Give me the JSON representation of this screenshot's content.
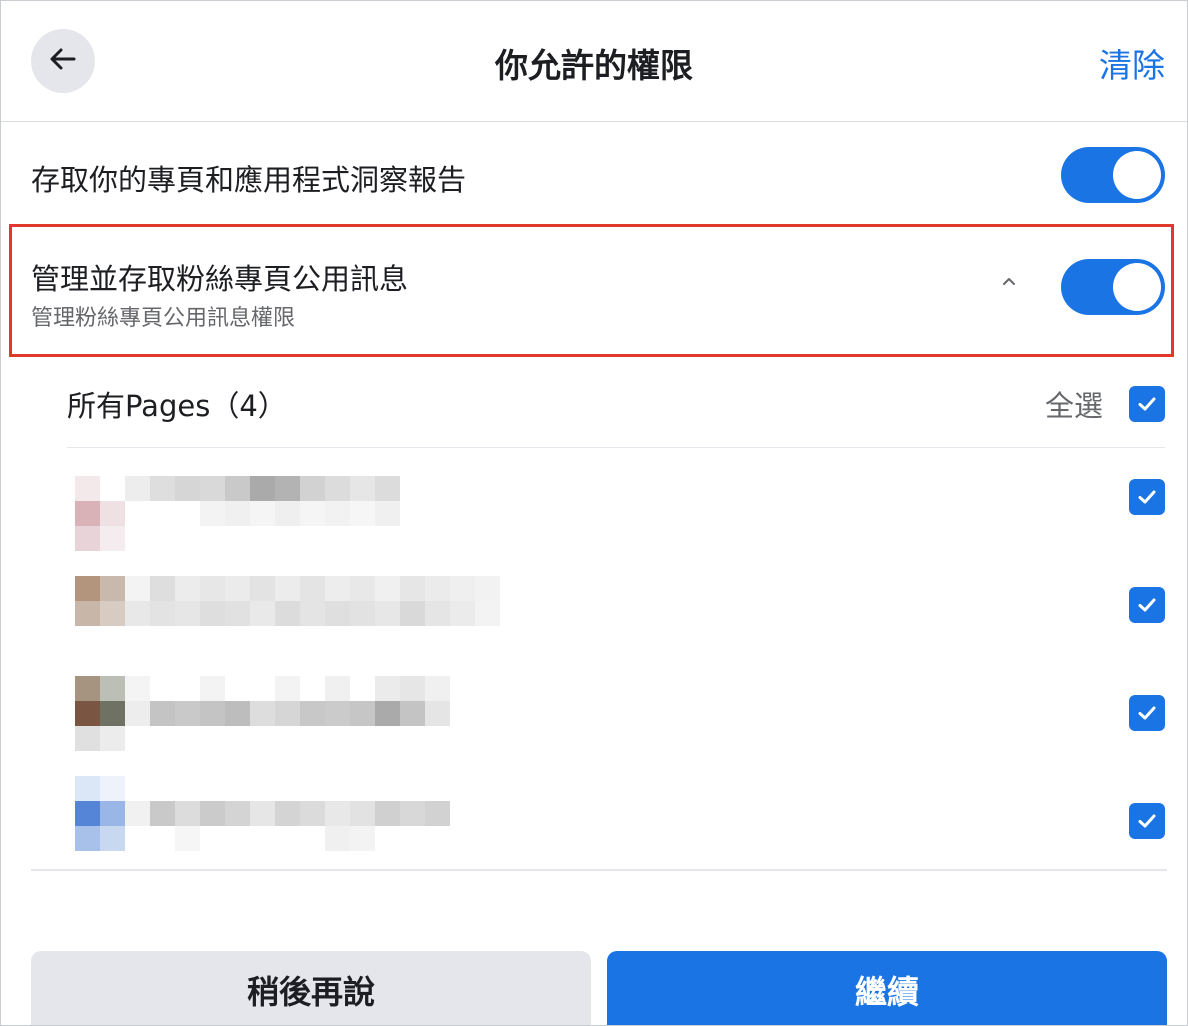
{
  "header": {
    "title": "你允許的權限",
    "clear_label": "清除",
    "back_icon": "arrow-left-icon"
  },
  "permissions": [
    {
      "title": "存取你的專頁和應用程式洞察報告",
      "enabled": true
    },
    {
      "title": "管理並存取粉絲專頁公用訊息",
      "subtitle": "管理粉絲專頁公用訊息權限",
      "enabled": true,
      "expanded": true,
      "expand_icon": "chevron-up-icon"
    }
  ],
  "pages": {
    "title": "所有Pages（4）",
    "select_all_label": "全選",
    "select_all_checked": true,
    "items": [
      {
        "checked": true
      },
      {
        "checked": true
      },
      {
        "checked": true
      },
      {
        "checked": true
      }
    ]
  },
  "footer": {
    "later_label": "稍後再說",
    "continue_label": "繼續"
  },
  "colors": {
    "accent": "#1b74e4",
    "highlight": "#e0392b",
    "secondary_text": "#65676b"
  }
}
